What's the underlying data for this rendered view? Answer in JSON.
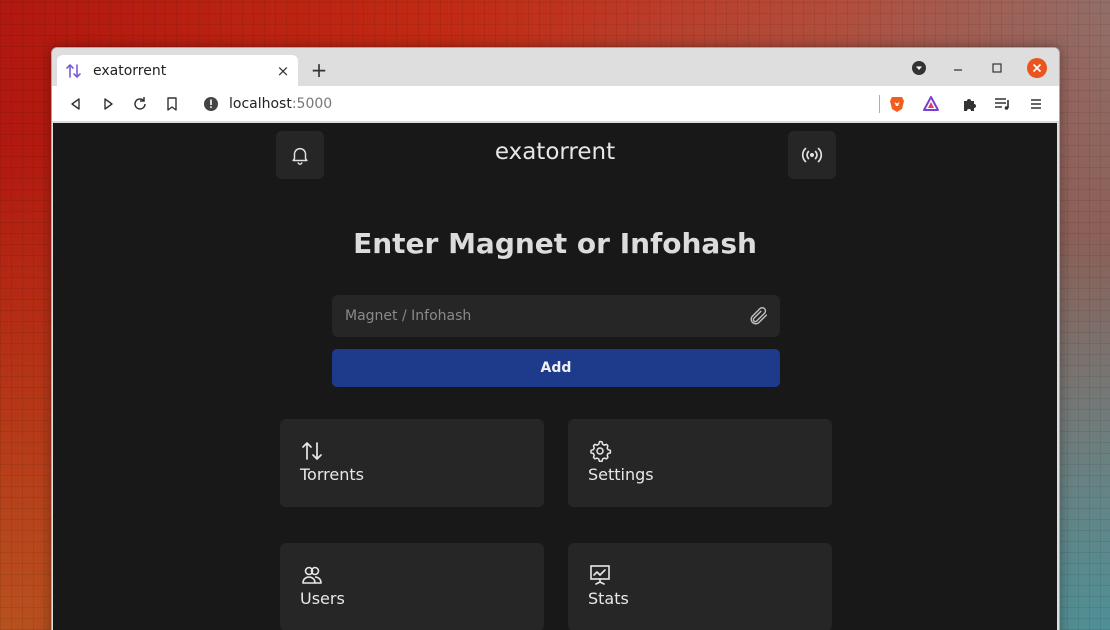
{
  "browser": {
    "tab_title": "exatorrent",
    "tab_close": "×",
    "new_tab": "+",
    "url_host": "localhost",
    "url_port": ":5000"
  },
  "app": {
    "title": "exatorrent",
    "heading": "Enter Magnet or Infohash",
    "magnet_placeholder": "Magnet / Infohash",
    "add_label": "Add",
    "cards": {
      "torrents": "Torrents",
      "settings": "Settings",
      "users": "Users",
      "stats": "Stats"
    }
  },
  "colors": {
    "page_bg": "#181818",
    "card_bg": "#262626",
    "add_button": "#1e3a8a"
  },
  "icons": {
    "notifications": "bell-icon",
    "connection": "broadcast-icon",
    "attach": "paperclip-icon",
    "torrents": "arrows-up-down-icon",
    "settings": "gear-icon",
    "users": "users-icon",
    "stats": "chart-icon"
  }
}
